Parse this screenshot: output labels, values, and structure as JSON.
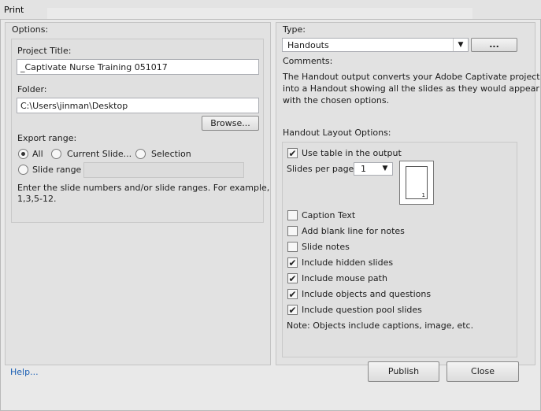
{
  "window": {
    "title": "Print"
  },
  "options": {
    "heading": "Options:",
    "project_title_label": "Project Title:",
    "project_title_value": "_Captivate Nurse Training 051017",
    "folder_label": "Folder:",
    "folder_value": "C:\\Users\\jinman\\Desktop",
    "browse_label": "Browse...",
    "export_range_label": "Export range:",
    "radio_all": "All",
    "radio_current": "Current Slide...",
    "radio_selection": "Selection",
    "radio_slide_range": "Slide range",
    "selected_range": "All",
    "hint_line1": "Enter the slide numbers and/or slide ranges. For example,",
    "hint_line2": "1,3,5-12."
  },
  "type_panel": {
    "type_label": "Type:",
    "type_value": "Handouts",
    "more_button": "...",
    "comments_label": "Comments:",
    "comments_line1": "The Handout output converts your Adobe Captivate project",
    "comments_line2": "into a Handout showing all the slides as they would appear",
    "comments_line3": "with the chosen options.",
    "layout_heading": "Handout Layout Options:",
    "use_table": {
      "label": "Use table in the output",
      "checked": true
    },
    "slides_per_page_label": "Slides per page",
    "slides_per_page_value": "1",
    "preview_number": "1",
    "checkboxes": [
      {
        "label": "Caption Text",
        "checked": false
      },
      {
        "label": "Add blank line for notes",
        "checked": false
      },
      {
        "label": "Slide notes",
        "checked": false
      },
      {
        "label": "Include hidden slides",
        "checked": true
      },
      {
        "label": "Include mouse path",
        "checked": true
      },
      {
        "label": "Include objects and questions",
        "checked": true
      },
      {
        "label": "Include question pool slides",
        "checked": true
      }
    ],
    "note": "Note: Objects include captions, image, etc."
  },
  "footer": {
    "help_link": "Help...",
    "publish_button": "Publish",
    "close_button": "Close"
  },
  "glyphs": {
    "check": "✔",
    "dropdown": "▼"
  }
}
